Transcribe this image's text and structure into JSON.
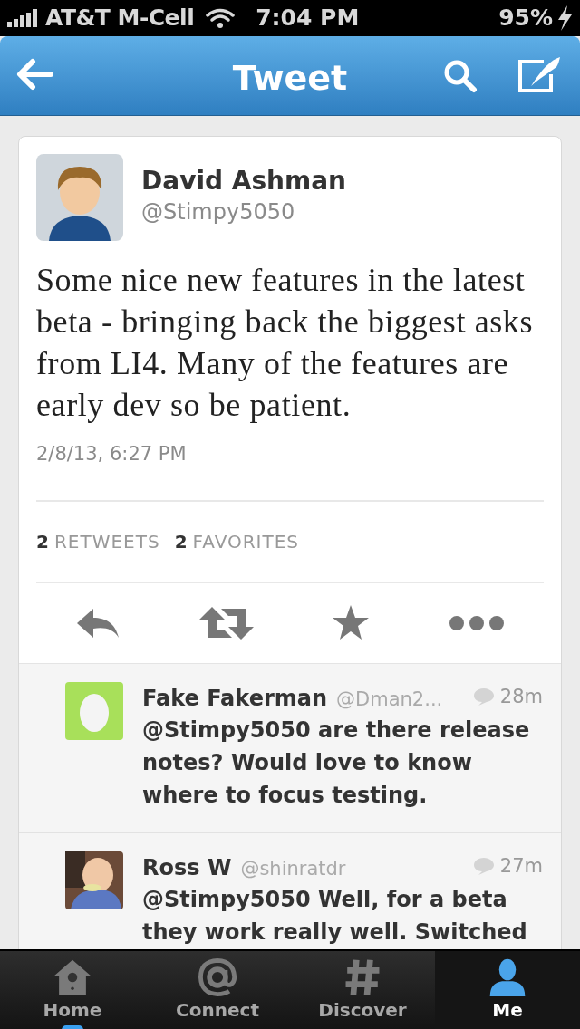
{
  "status_bar": {
    "carrier": "AT&T M-Cell",
    "time": "7:04 PM",
    "battery": "95%"
  },
  "nav_bar": {
    "title": "Tweet"
  },
  "tweet": {
    "name": "David Ashman",
    "handle": "@Stimpy5050",
    "text": "Some nice new features in the latest beta - bringing back the biggest asks from LI4.  Many of the features are early dev so be patient.",
    "timestamp": "2/8/13, 6:27 PM",
    "stats": [
      {
        "count": "2",
        "label": "RETWEETS"
      },
      {
        "count": "2",
        "label": "FAVORITES"
      }
    ],
    "actions": [
      {
        "kind": "reply"
      },
      {
        "kind": "retweet"
      },
      {
        "kind": "favorite"
      },
      {
        "kind": "more"
      }
    ]
  },
  "replies": [
    {
      "kind": "egg",
      "name": "Fake Fakerman",
      "handle": "@Dman2...",
      "time": "28m",
      "text": "@Stimpy5050 are there release notes? Would love to know where to focus testing."
    },
    {
      "kind": "picture",
      "name": "Ross W",
      "handle": "@shinratdr",
      "time": "27m",
      "text": "@Stimpy5050 Well, for a beta they work really well. Switched"
    }
  ],
  "tab_bar": [
    {
      "kind": "home",
      "label": "Home",
      "selected": false,
      "unread": true
    },
    {
      "kind": "connect",
      "label": "Connect",
      "selected": false,
      "unread": false
    },
    {
      "kind": "discover",
      "label": "Discover",
      "selected": false,
      "unread": false
    },
    {
      "kind": "me",
      "label": "Me",
      "selected": true,
      "unread": false
    }
  ]
}
